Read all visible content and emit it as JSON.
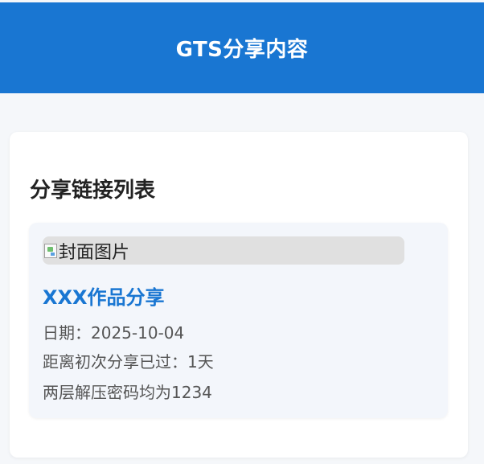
{
  "header": {
    "title": "GTS分享内容"
  },
  "panel": {
    "title": "分享链接列表"
  },
  "shares": [
    {
      "cover_alt": "封面图片",
      "title": "XXX作品分享",
      "date_line": "日期：2025-10-04",
      "elapsed_line": "距离初次分享已过：1天",
      "password_line": "两层解压密码均为1234"
    }
  ],
  "colors": {
    "header_bg": "#1976d2",
    "link_blue": "#1976d2",
    "page_bg": "#f5f7fa",
    "card_bg": "#f3f6fb"
  },
  "icons": {
    "cover": "broken-image-icon"
  }
}
